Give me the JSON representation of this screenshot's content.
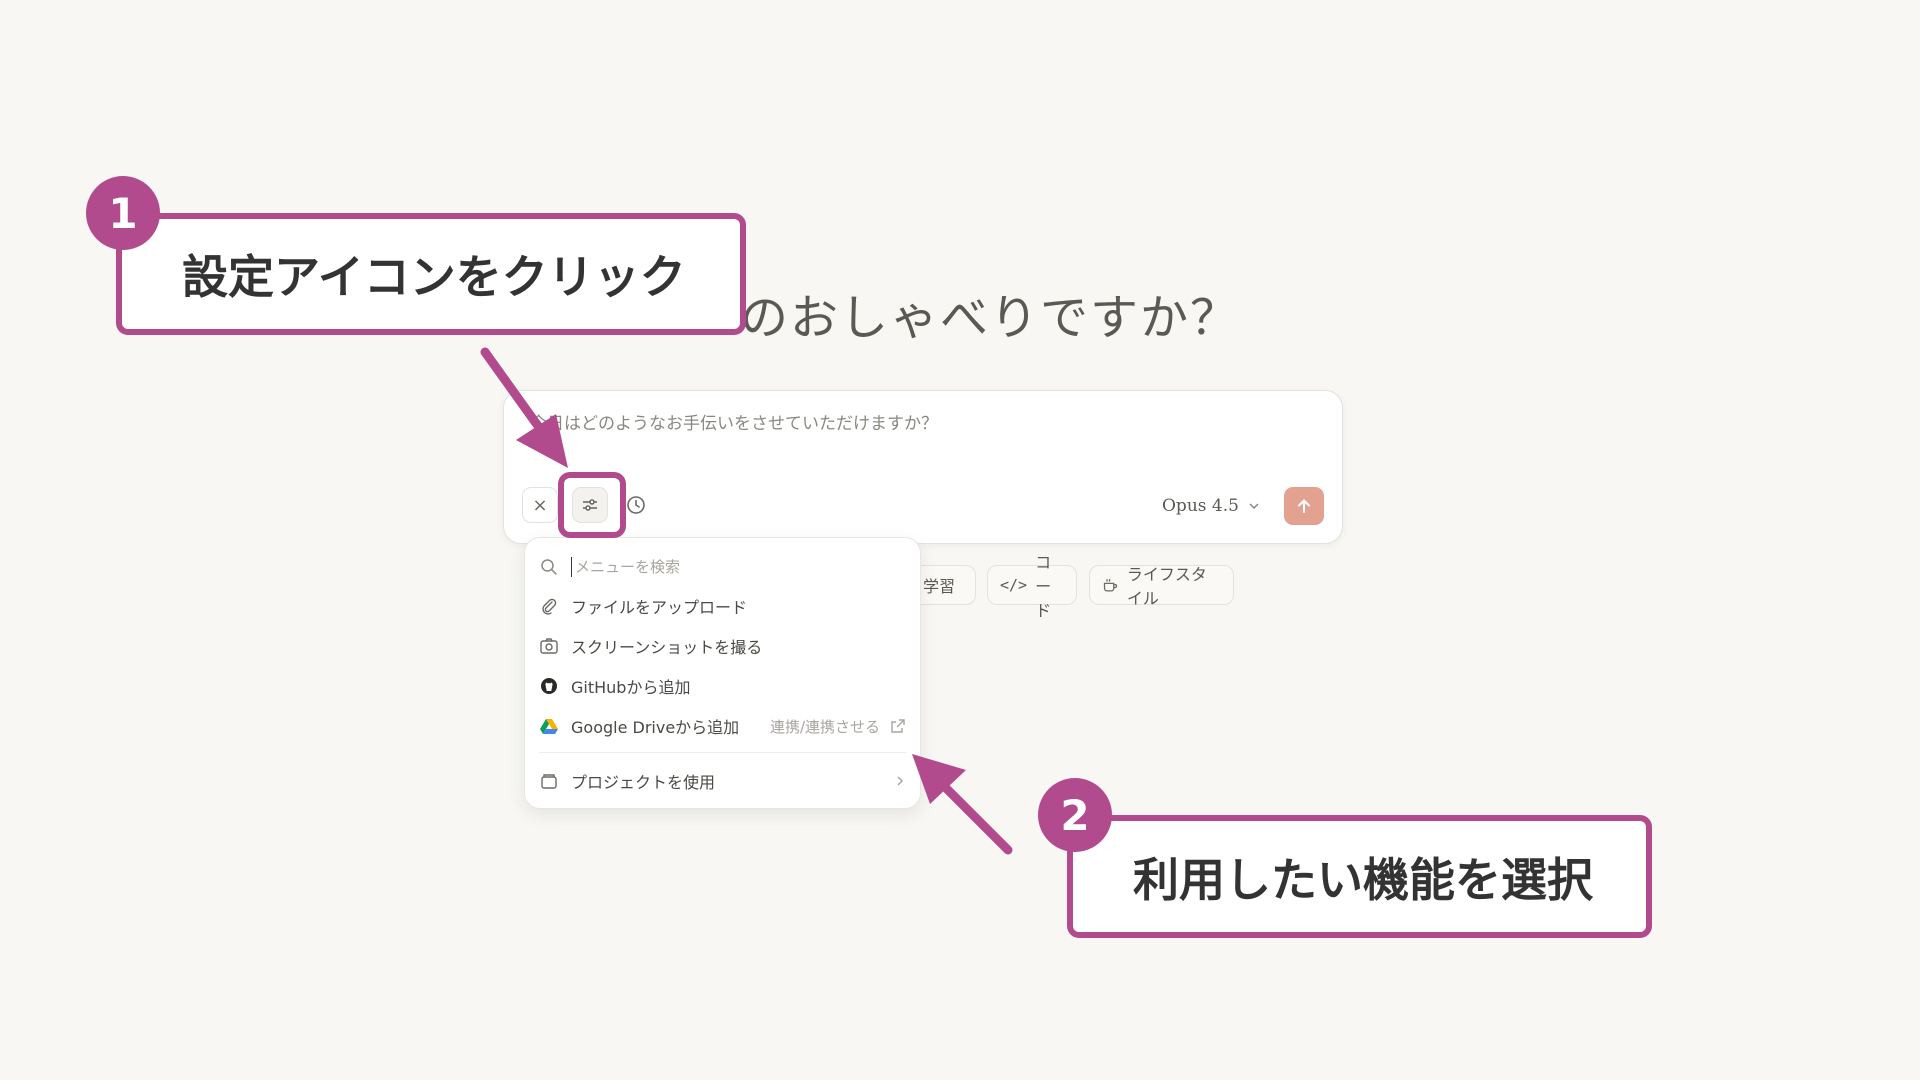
{
  "greeting": "のおしゃべりですか？",
  "chat": {
    "placeholder": "今日はどのようなお手伝いをさせていただけますか？",
    "model": "Opus 4.5"
  },
  "chips": {
    "learn": "学習",
    "code": "コード",
    "lifestyle": "ライフスタイル"
  },
  "menu": {
    "search_placeholder": "メニューを検索",
    "items": [
      {
        "label": "ファイルをアップロード",
        "icon": "paperclip-icon"
      },
      {
        "label": "スクリーンショットを撮る",
        "icon": "camera-icon"
      },
      {
        "label": "GitHubから追加",
        "icon": "github-icon"
      },
      {
        "label": "Google Driveから追加",
        "icon": "google-drive-icon",
        "side": "連携/連携させる"
      },
      {
        "label": "プロジェクトを使用",
        "icon": "project-box-icon"
      }
    ]
  },
  "annotations": {
    "step1_number": "1",
    "step1_text": "設定アイコンをクリック",
    "step2_number": "2",
    "step2_text": "利用したい機能を選択",
    "color": "#b24a8e"
  },
  "colors": {
    "background": "#f8f7f4",
    "send_button": "#e3a28f"
  }
}
